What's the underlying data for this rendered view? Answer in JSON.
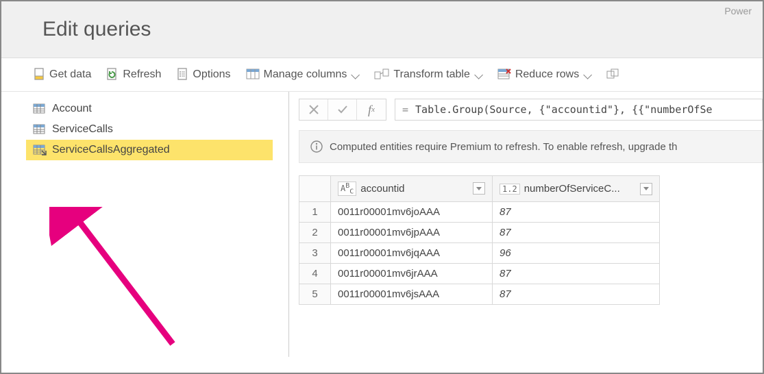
{
  "appLabel": "Power",
  "title": "Edit queries",
  "toolbar": {
    "getData": "Get data",
    "refresh": "Refresh",
    "options": "Options",
    "manageColumns": "Manage columns",
    "transformTable": "Transform table",
    "reduceRows": "Reduce rows"
  },
  "queries": [
    {
      "name": "Account",
      "selected": false,
      "special": false
    },
    {
      "name": "ServiceCalls",
      "selected": false,
      "special": false
    },
    {
      "name": "ServiceCallsAggregated",
      "selected": true,
      "special": true
    }
  ],
  "formula": {
    "eq": "=",
    "text": "Table.Group(Source, {\"accountid\"}, {{\"numberOfSe"
  },
  "banner": "Computed entities require Premium to refresh. To enable refresh, upgrade th",
  "grid": {
    "columns": [
      {
        "type": "ABC",
        "label": "accountid"
      },
      {
        "type": "1.2",
        "label": "numberOfServiceC..."
      }
    ],
    "rows": [
      {
        "n": "1",
        "accountid": "0011r00001mv6joAAA",
        "num": "87"
      },
      {
        "n": "2",
        "accountid": "0011r00001mv6jpAAA",
        "num": "87"
      },
      {
        "n": "3",
        "accountid": "0011r00001mv6jqAAA",
        "num": "96"
      },
      {
        "n": "4",
        "accountid": "0011r00001mv6jrAAA",
        "num": "87"
      },
      {
        "n": "5",
        "accountid": "0011r00001mv6jsAAA",
        "num": "87"
      }
    ]
  }
}
